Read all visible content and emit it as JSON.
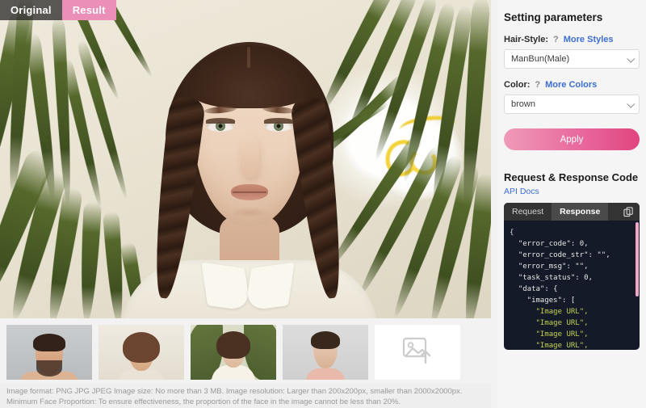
{
  "view_tabs": [
    {
      "label": "Original",
      "active": false
    },
    {
      "label": "Result",
      "active": true
    }
  ],
  "settings": {
    "title": "Setting parameters",
    "hair_style": {
      "label": "Hair-Style:",
      "help": "?",
      "more_link": "More Styles",
      "value": "ManBun(Male)"
    },
    "color": {
      "label": "Color:",
      "help": "?",
      "more_link": "More Colors",
      "value": "brown"
    },
    "apply_label": "Apply"
  },
  "code_panel": {
    "title": "Request & Response Code",
    "api_docs": "API Docs",
    "tabs": [
      {
        "label": "Request",
        "active": false
      },
      {
        "label": "Response",
        "active": true
      }
    ],
    "copy_icon": "copy-icon",
    "lines": [
      "{",
      "  \"error_code\": 0,",
      "  \"error_code_str\": \"\",",
      "  \"error_msg\": \"\",",
      "  \"task_status\": 0,",
      "  \"data\": {",
      "    \"images\": [",
      "      \"Image URL\",",
      "      \"Image URL\",",
      "      \"Image URL\",",
      "      \"Image URL\","
    ]
  },
  "thumbnails": [
    {
      "name": "thumb-man-beard",
      "selected": false
    },
    {
      "name": "thumb-short-hair-woman",
      "selected": false
    },
    {
      "name": "thumb-woman-palm-background",
      "selected": true
    },
    {
      "name": "thumb-woman-grey-background",
      "selected": false
    },
    {
      "name": "thumb-upload-placeholder",
      "selected": false,
      "icon": "image-upload-icon"
    }
  ],
  "notice": "Image format: PNG JPG JPEG Image size: No more than 3 MB. Image resolution: Larger than 200x200px, smaller than 2000x2000px. Minimum Face Proportion: To ensure effectiveness, the proportion of the face in the image cannot be less than 20%.",
  "colors": {
    "accent_pink": "#e8568f",
    "link_blue": "#3b6fd4",
    "code_bg": "#141a28",
    "result_tab": "#eb8fb8"
  }
}
